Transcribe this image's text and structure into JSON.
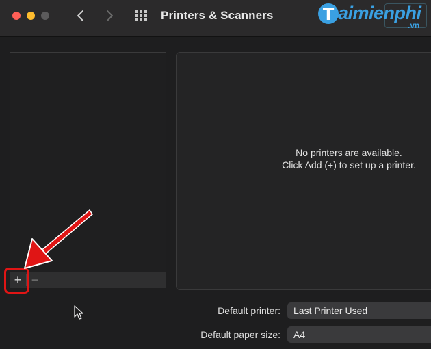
{
  "window": {
    "title": "Printers & Scanners"
  },
  "brand": {
    "name": "aimienphi",
    "suffix": ".vn"
  },
  "printer_list": {
    "add_label": "+",
    "remove_label": "−"
  },
  "detail": {
    "message_line1": "No printers are available.",
    "message_line2": "Click Add (+) to set up a printer."
  },
  "settings": {
    "default_printer_label": "Default printer:",
    "default_printer_value": "Last Printer Used",
    "paper_size_label": "Default paper size:",
    "paper_size_value": "A4"
  },
  "colors": {
    "accent_annotation": "#e01515",
    "brand_blue": "#3aa0e2"
  }
}
